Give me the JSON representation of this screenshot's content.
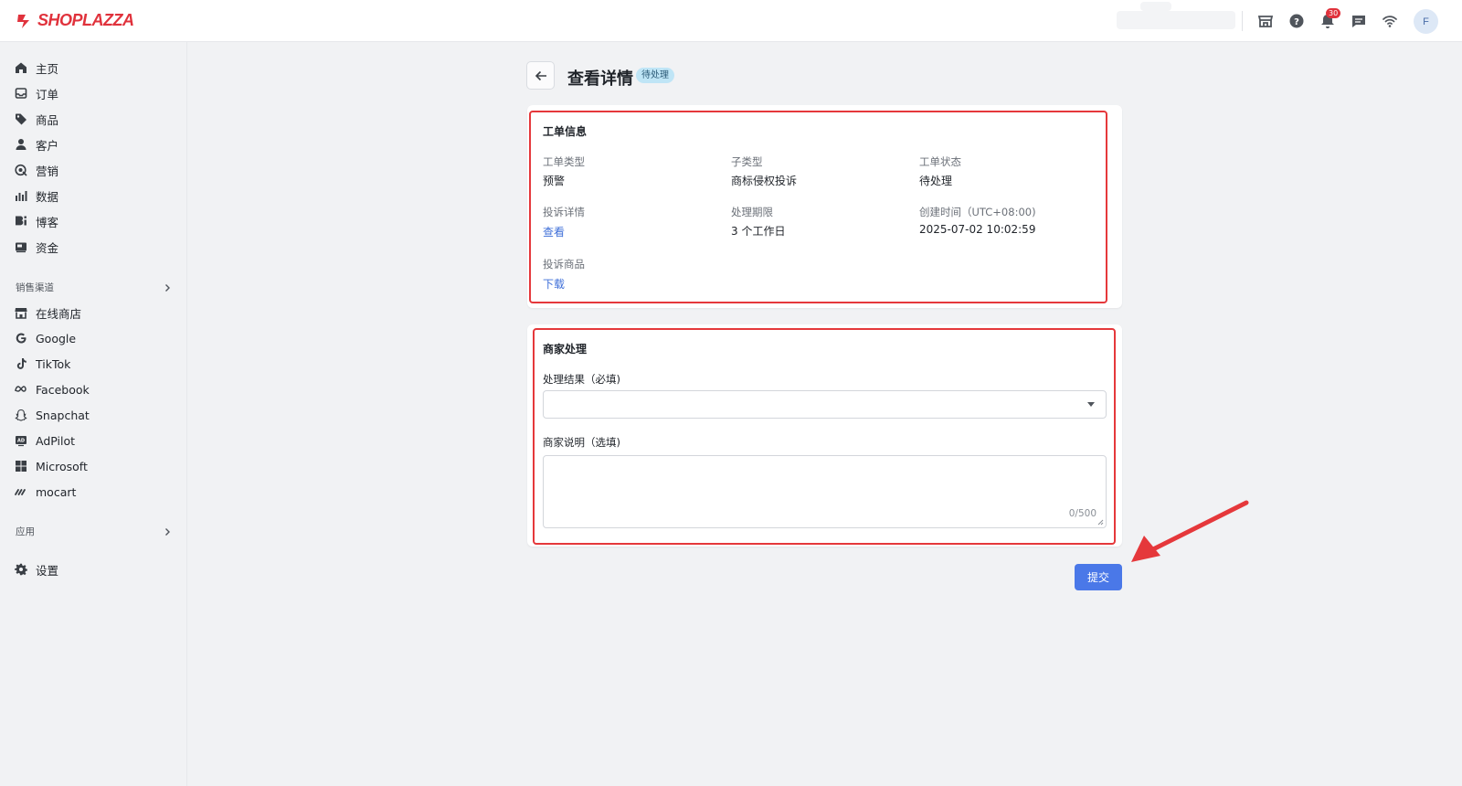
{
  "brand": {
    "name": "SHOPLAZZA",
    "color": "#e0323c"
  },
  "topbar": {
    "icons": [
      "store-icon",
      "help-icon",
      "bell-icon",
      "chat-icon",
      "wifi-icon"
    ],
    "notification_count": "30",
    "avatar_initial": "F"
  },
  "sidebar": {
    "items": [
      {
        "label": "主页",
        "icon": "home-icon"
      },
      {
        "label": "订单",
        "icon": "inbox-icon"
      },
      {
        "label": "商品",
        "icon": "tag-icon"
      },
      {
        "label": "客户",
        "icon": "user-icon"
      },
      {
        "label": "营销",
        "icon": "marketing-icon"
      },
      {
        "label": "数据",
        "icon": "bar-chart-icon"
      },
      {
        "label": "博客",
        "icon": "blog-icon"
      },
      {
        "label": "资金",
        "icon": "wallet-icon"
      }
    ],
    "sales_channels_label": "销售渠道",
    "channels": [
      {
        "label": "在线商店",
        "icon": "store-icon"
      },
      {
        "label": "Google",
        "icon": "google-icon"
      },
      {
        "label": "TikTok",
        "icon": "tiktok-icon"
      },
      {
        "label": "Facebook",
        "icon": "meta-icon"
      },
      {
        "label": "Snapchat",
        "icon": "snapchat-icon"
      },
      {
        "label": "AdPilot",
        "icon": "adpilot-icon"
      },
      {
        "label": "Microsoft",
        "icon": "microsoft-icon"
      },
      {
        "label": "mocart",
        "icon": "mocart-icon"
      }
    ],
    "apps_label": "应用",
    "settings_label": "设置"
  },
  "page": {
    "title": "查看详情",
    "status_tag": "待处理"
  },
  "ticket_info": {
    "title": "工单信息",
    "type_label": "工单类型",
    "type_value": "预警",
    "subtype_label": "子类型",
    "subtype_value": "商标侵权投诉",
    "status_label": "工单状态",
    "status_value": "待处理",
    "complaint_label": "投诉详情",
    "complaint_link": "查看",
    "deadline_label": "处理期限",
    "deadline_value": "3 个工作日",
    "created_label": "创建时间（UTC+08:00)",
    "created_value": "2025-07-02 10:02:59",
    "product_label": "投诉商品",
    "product_link": "下载"
  },
  "merchant": {
    "title": "商家处理",
    "result_label": "处理结果（必填)",
    "result_value": "",
    "note_label": "商家说明（选填)",
    "note_value": "",
    "note_counter": "0/500"
  },
  "actions": {
    "submit_label": "提交",
    "submit_color": "#4a78e8"
  },
  "annotation_color": "#e5383b"
}
